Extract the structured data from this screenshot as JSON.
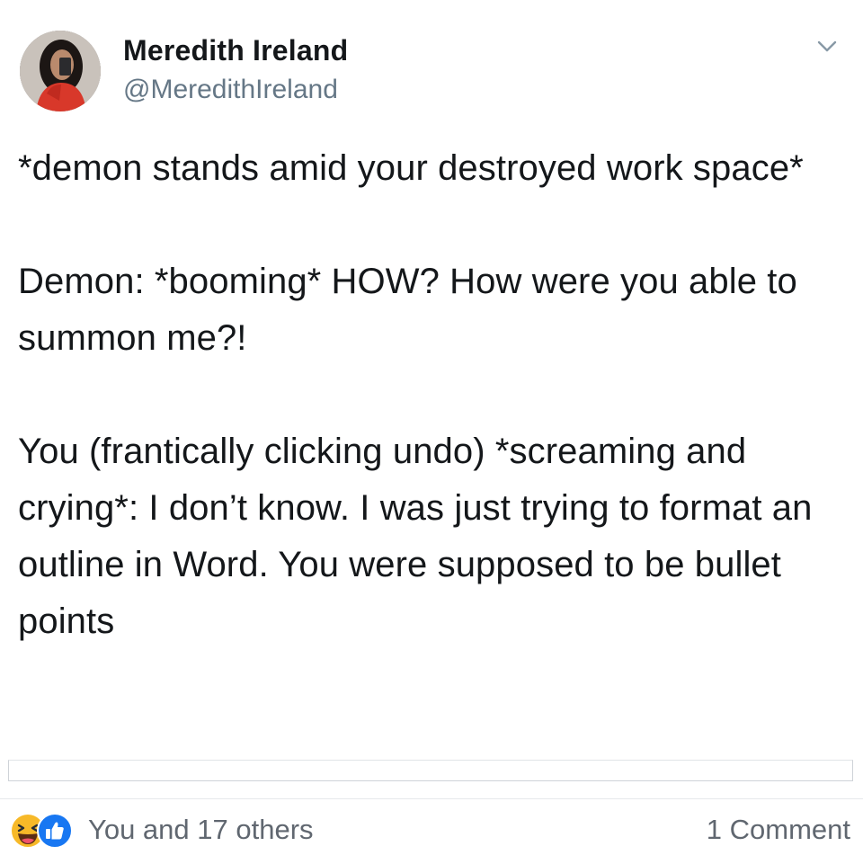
{
  "post": {
    "author": {
      "display_name": "Meredith Ireland",
      "handle": "@MeredithIreland",
      "avatar": "avatar-photo"
    },
    "menu_icon": "chevron-down-icon",
    "paragraphs": [
      "*demon stands amid your destroyed work space*",
      "Demon: *booming* HOW? How were you able to summon me?!",
      "You (frantically clicking undo) *screaming and crying*: I don’t know. I was just trying to format an outline in Word. You were supposed to be bullet points"
    ]
  },
  "footer": {
    "reaction_icons": [
      "haha-reaction-icon",
      "like-reaction-icon"
    ],
    "reactions_text": "You and 17 others",
    "comments_text": "1 Comment",
    "colors": {
      "like": "#1877f2",
      "haha": "#f7b928"
    }
  }
}
